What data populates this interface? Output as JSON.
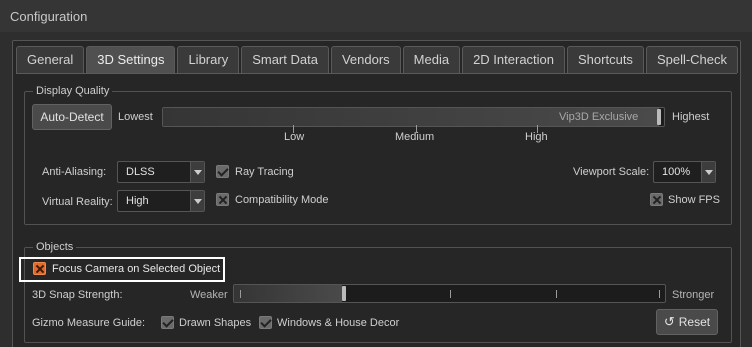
{
  "window": {
    "title": "Configuration"
  },
  "tabs": [
    "General",
    "3D Settings",
    "Library",
    "Smart Data",
    "Vendors",
    "Media",
    "2D Interaction",
    "Shortcuts",
    "Spell-Check"
  ],
  "display_quality": {
    "legend": "Display Quality",
    "auto_detect_label": "Auto-Detect",
    "lowest_label": "Lowest",
    "highest_label": "Highest",
    "slider_value_label": "Vip3D Exclusive",
    "slider_value_fraction": 1.0,
    "tick_labels": [
      "Low",
      "Medium",
      "High"
    ],
    "anti_aliasing": {
      "label": "Anti-Aliasing:",
      "value": "DLSS"
    },
    "virtual_reality": {
      "label": "Virtual Reality:",
      "value": "High"
    },
    "ray_tracing": {
      "label": "Ray Tracing",
      "checked": true
    },
    "compatibility_mode": {
      "label": "Compatibility Mode",
      "checked": false
    },
    "viewport_scale": {
      "label": "Viewport Scale:",
      "value": "100%"
    },
    "show_fps": {
      "label": "Show FPS",
      "checked": false
    }
  },
  "objects": {
    "legend": "Objects",
    "focus_camera": {
      "label": "Focus Camera on Selected Object",
      "checked": false
    },
    "snap_strength": {
      "label": "3D Snap Strength:",
      "weaker_label": "Weaker",
      "stronger_label": "Stronger",
      "value_fraction": 0.25
    },
    "gizmo": {
      "label": "Gizmo Measure Guide:",
      "drawn_shapes": "Drawn Shapes",
      "windows_decor": "Windows & House Decor",
      "drawn_checked": true,
      "windows_checked": true
    },
    "reset_label": "Reset"
  },
  "colors": {
    "accent": "#e06a2c",
    "highlight": "#ffffff"
  }
}
